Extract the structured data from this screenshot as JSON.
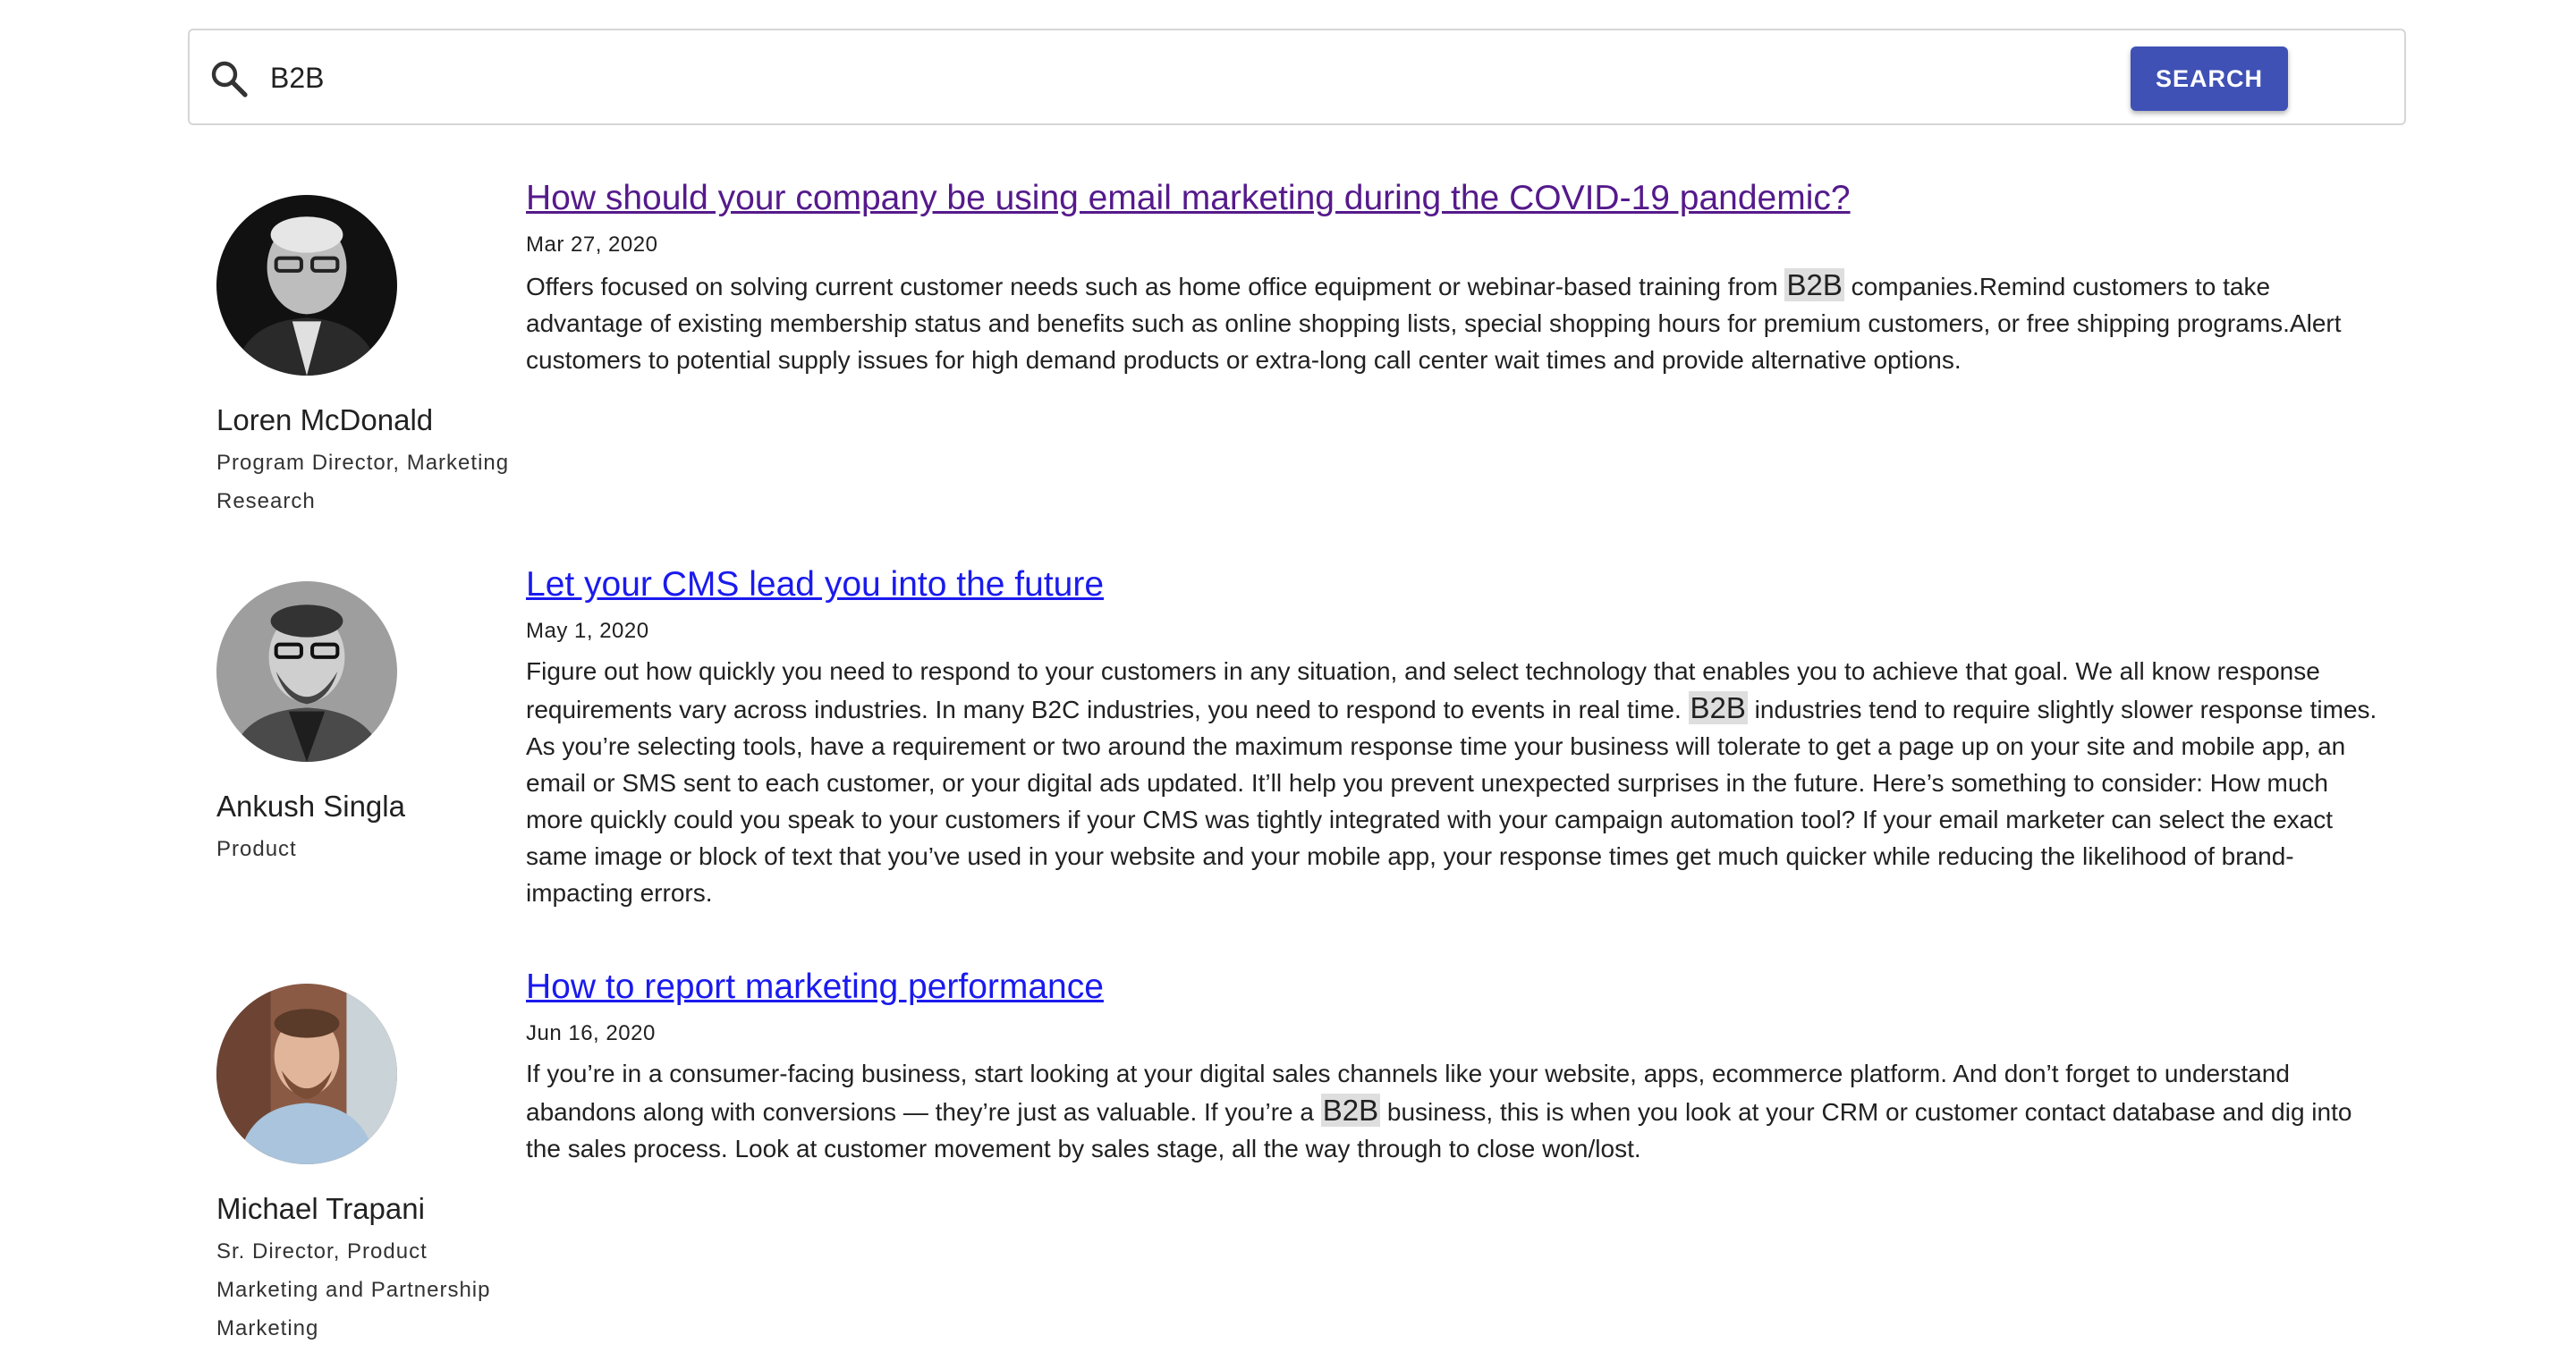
{
  "search": {
    "value": "B2B",
    "button_label": "SEARCH"
  },
  "results": [
    {
      "title": "How should your company be using email marketing during the COVID-19 pandemic?",
      "visited": true,
      "date": "Mar 27, 2020",
      "author": {
        "name": "Loren McDonald",
        "role": "Program Director, Marketing Research"
      },
      "snippet_parts": [
        "Offers focused on solving current customer needs such as home office equipment or webinar-based training from ",
        "B2B",
        " companies.Remind customers to take advantage of existing membership status and benefits such as online shopping lists, special shopping hours for premium customers, or free shipping programs.Alert customers to potential supply issues for high demand products or extra-long call center wait times and provide alternative options."
      ]
    },
    {
      "title": "Let your CMS lead you into the future",
      "visited": false,
      "date": "May 1, 2020",
      "author": {
        "name": "Ankush Singla",
        "role": "Product"
      },
      "snippet_parts": [
        "Figure out how quickly you need to respond to your customers in any situation, and select technology that enables you to achieve that goal. We all know response requirements vary across industries. In many B2C industries, you need to respond to events in real time. ",
        "B2B",
        " industries tend to require slightly slower response times. As you’re selecting tools, have a requirement or two around the maximum response time your business will tolerate to get a page up on your site and mobile app, an email or SMS sent to each customer, or your digital ads updated. It’ll help you prevent unexpected surprises in the future. Here’s something to consider: How much more quickly could you speak to your customers if your CMS was tightly integrated with your campaign automation tool? If your email marketer can select the exact same image or block of text that you’ve used in your website and your mobile app, your response times get much quicker while reducing the likelihood of brand-impacting errors."
      ]
    },
    {
      "title": "How to report marketing performance",
      "visited": false,
      "date": "Jun 16, 2020",
      "author": {
        "name": "Michael Trapani",
        "role": "Sr. Director, Product Marketing and Partnership Marketing"
      },
      "snippet_parts": [
        "If you’re in a consumer-facing business, start looking at your digital sales channels like your website, apps, ecommerce platform. And don’t forget to understand abandons along with conversions — they’re just as valuable. If you’re a ",
        "B2B",
        " business, this is when you look at your CRM or customer contact database and dig into the sales process. Look at customer movement by sales stage, all the way through to close won/lost."
      ]
    }
  ]
}
